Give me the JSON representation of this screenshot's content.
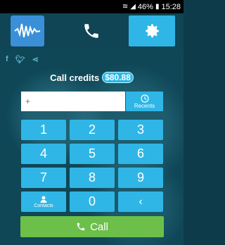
{
  "status": {
    "battery": "46%",
    "time": "15:28"
  },
  "credits": {
    "label": "Call credits",
    "amount": "$80.88"
  },
  "input": {
    "placeholder": "+",
    "value": ""
  },
  "recents": {
    "label": "Recents"
  },
  "keys": [
    "1",
    "2",
    "3",
    "4",
    "5",
    "6",
    "7",
    "8",
    "9",
    "",
    "0",
    ""
  ],
  "contacts_label": "Contacts",
  "call_label": "Call",
  "colors": {
    "accent": "#2fb6e6",
    "call": "#6cc04a",
    "background": "#0f4757"
  }
}
